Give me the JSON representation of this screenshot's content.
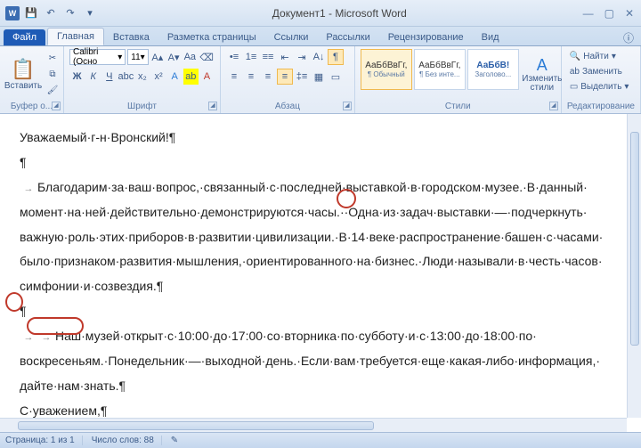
{
  "titlebar": {
    "title": "Документ1 - Microsoft Word",
    "word_letter": "W"
  },
  "tabs": {
    "file": "Файл",
    "home": "Главная",
    "insert": "Вставка",
    "layout": "Разметка страницы",
    "refs": "Ссылки",
    "mail": "Рассылки",
    "review": "Рецензирование",
    "view": "Вид"
  },
  "ribbon": {
    "clipboard": {
      "paste": "Вставить",
      "group": "Буфер о..."
    },
    "font": {
      "name": "Calibri (Осно",
      "size": "11",
      "group": "Шрифт"
    },
    "paragraph": {
      "group": "Абзац"
    },
    "styles": {
      "group": "Стили",
      "change": "Изменить\nстили",
      "items": [
        {
          "prev": "АаБбВвГг,",
          "name": "¶ Обычный"
        },
        {
          "prev": "АаБбВвГг,",
          "name": "¶ Без инте..."
        },
        {
          "prev": "АаБбВ!",
          "name": "Заголово..."
        }
      ]
    },
    "editing": {
      "find": "Найти",
      "replace": "Заменить",
      "select": "Выделить",
      "group": "Редактирование"
    }
  },
  "doc": {
    "p1": "Уважаемый·г-н·Вронский!¶",
    "p2": "¶",
    "p3a": "Благодарим·за·ваш·вопрос,·связанный·с·последней·выставкой·в·городском·музее.·В·данный·",
    "p3b": "момент·на·ней·действительно·демонстрируются·часы.··Одна·из·задач·выставки·—·подчеркнуть·",
    "p3c": "важную·роль·этих·приборов·в·развитии·цивилизации.·В·14·веке·распространение·башен·с·часами·",
    "p3d": "было·признаком·развития·мышления,·ориентированного·на·бизнес.·Люди·называли·в·честь·часов·",
    "p3e": "симфонии·и·созвездия.¶",
    "p4": "¶",
    "p5a": "Наш·музей·открыт·с·10:00·до·17:00·со·вторника·по·субботу·и·с·13:00·до·18:00·по·",
    "p5b": "воскресеньям.·Понедельник·—·выходной·день.·Если·вам·требуется·еще·какая-либо·информация,·",
    "p5c": "дайте·нам·знать.¶",
    "p6": "С·уважением,¶",
    "p7": "¶"
  },
  "status": {
    "page": "Страница: 1 из 1",
    "words": "Число слов: 88"
  }
}
